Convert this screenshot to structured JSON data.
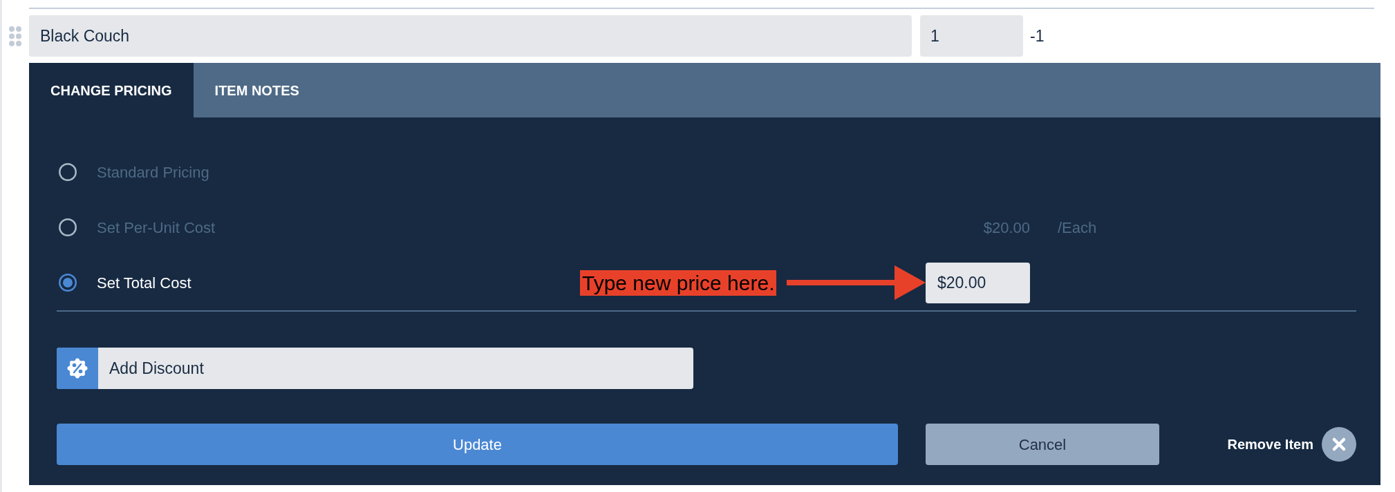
{
  "item": {
    "name": "Black Couch",
    "quantity": "1",
    "difference": "-1"
  },
  "tabs": [
    {
      "label": "CHANGE PRICING",
      "selected": true
    },
    {
      "label": "ITEM NOTES",
      "selected": false
    }
  ],
  "pricing_options": [
    {
      "kind": "plain",
      "label": "Standard Pricing",
      "selected": false
    },
    {
      "kind": "rate",
      "label": "Set Per-Unit Cost",
      "selected": false,
      "amount": "$20.00",
      "unit": "/Each"
    },
    {
      "kind": "input",
      "label": "Set Total Cost",
      "selected": true,
      "annotation": "Type new price here.",
      "value": "$20.00"
    }
  ],
  "discount": {
    "label": "Add Discount"
  },
  "buttons": [
    {
      "kind": "primary",
      "label": "Update"
    },
    {
      "kind": "secondary",
      "label": "Cancel"
    }
  ],
  "remove": {
    "label": "Remove Item"
  }
}
